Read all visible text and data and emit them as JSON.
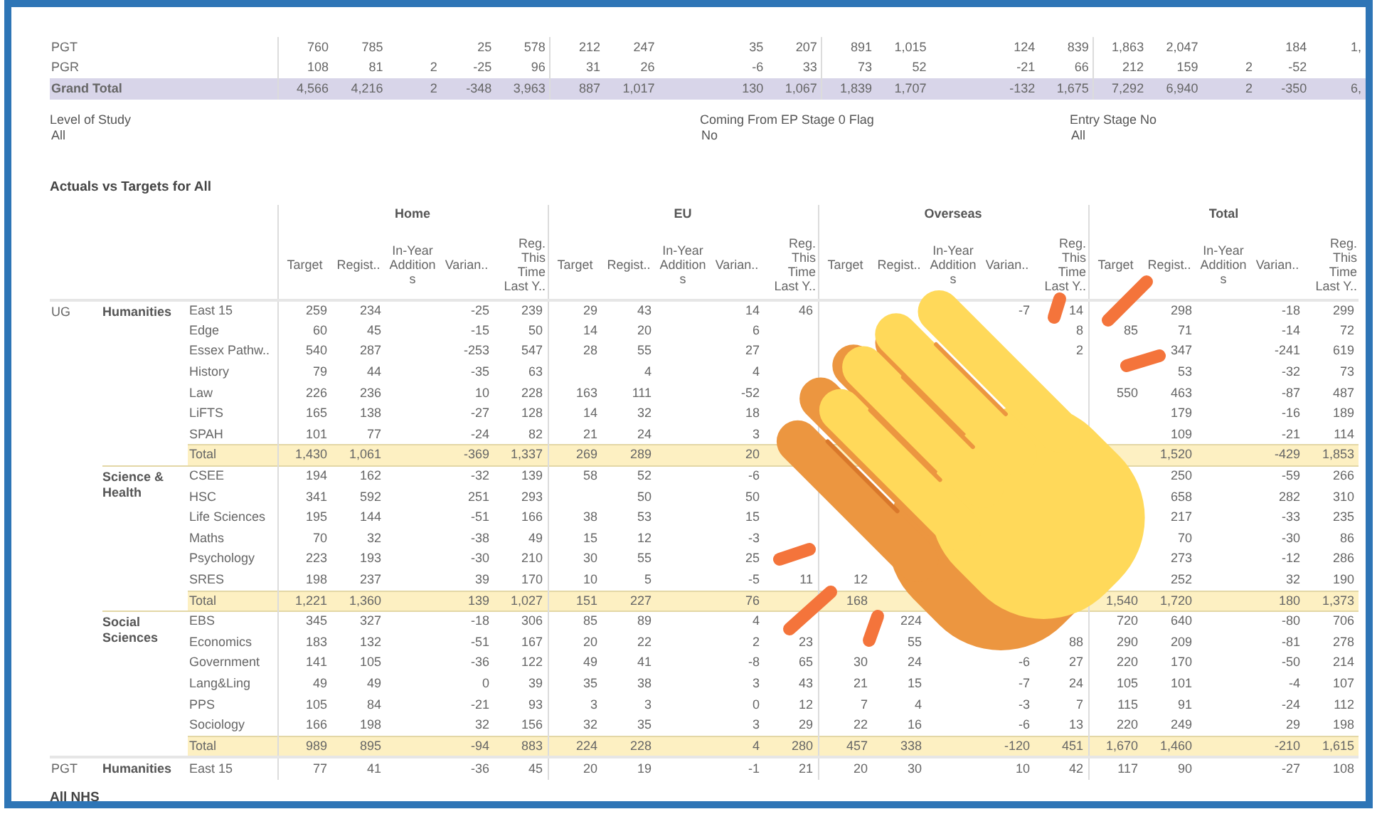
{
  "summary_table": {
    "rows": [
      {
        "label": "PGT",
        "kind": "detail",
        "cells": [
          {
            "target": "760",
            "regist": "785",
            "varian": "25",
            "last_year": "578"
          },
          {
            "target": "212",
            "regist": "247",
            "varian": "35",
            "last_year": "207"
          },
          {
            "target": "891",
            "regist": "1,015",
            "varian": "124",
            "last_year": "839"
          },
          {
            "target": "1,863",
            "regist": "2,047",
            "varian": "184",
            "last_year": "1,"
          }
        ]
      },
      {
        "label": "PGR",
        "kind": "detail",
        "cells": [
          {
            "target": "108",
            "regist": "81",
            "additions": "2",
            "varian": "-25",
            "last_year": "96"
          },
          {
            "target": "31",
            "regist": "26",
            "varian": "-6",
            "last_year": "33"
          },
          {
            "target": "73",
            "regist": "52",
            "varian": "-21",
            "last_year": "66"
          },
          {
            "target": "212",
            "regist": "159",
            "additions": "2",
            "varian": "-52"
          }
        ]
      },
      {
        "label": "Grand Total",
        "kind": "grand_total",
        "cells": [
          {
            "target": "4,566",
            "regist": "4,216",
            "additions": "2",
            "varian": "-348",
            "last_year": "3,963"
          },
          {
            "target": "887",
            "regist": "1,017",
            "varian": "130",
            "last_year": "1,067"
          },
          {
            "target": "1,839",
            "regist": "1,707",
            "varian": "-132",
            "last_year": "1,675"
          },
          {
            "target": "7,292",
            "regist": "6,940",
            "additions": "2",
            "varian": "-350",
            "last_year": "6,"
          }
        ]
      }
    ]
  },
  "filters": [
    {
      "label": "Level of Study",
      "value": "All"
    },
    {
      "label": "Coming From EP Stage 0 Flag",
      "value": "No"
    },
    {
      "label": "Entry Stage No",
      "value": "All"
    }
  ],
  "main_table": {
    "title": "Actuals vs Targets for All",
    "groups": [
      {
        "label": "Home",
        "columns": [
          "Target",
          "Regist..",
          "In-Year Additions",
          "Varian..",
          "Reg. This Time Last Y.."
        ]
      },
      {
        "label": "EU",
        "columns": [
          "Target",
          "Regist..",
          "In-Year Additions",
          "Varian..",
          "Reg. This Time Last Y.."
        ]
      },
      {
        "label": "Overseas",
        "columns": [
          "Target",
          "Regist..",
          "In-Year Additions",
          "Varian..",
          "Reg. This Time Last Y.."
        ]
      },
      {
        "label": "Total",
        "columns": [
          "Target",
          "Regist..",
          "In-Year Additions",
          "Varian..",
          "Reg. This Time Last Y.."
        ]
      }
    ],
    "row_groups": [
      {
        "label": "UG",
        "children": [
          {
            "label": "Humanities",
            "rows": [
              {
                "label": "East 15",
                "kind": "detail",
                "cells": [
                  {
                    "target": "259",
                    "regist": "234",
                    "varian": "-25",
                    "last_year": "239"
                  },
                  {
                    "target": "29",
                    "regist": "43",
                    "varian": "14",
                    "last_year": "46"
                  },
                  {
                    "varian": "-7",
                    "last_year": "14"
                  },
                  {
                    "regist": "298",
                    "varian": "-18",
                    "last_year": "299"
                  }
                ]
              },
              {
                "label": "Edge",
                "kind": "detail",
                "cells": [
                  {
                    "target": "60",
                    "regist": "45",
                    "varian": "-15",
                    "last_year": "50"
                  },
                  {
                    "target": "14",
                    "regist": "20",
                    "varian": "6"
                  },
                  {
                    "last_year": "8"
                  },
                  {
                    "target": "85",
                    "regist": "71",
                    "varian": "-14",
                    "last_year": "72"
                  }
                ]
              },
              {
                "label": "Essex Pathw..",
                "kind": "detail",
                "cells": [
                  {
                    "target": "540",
                    "regist": "287",
                    "varian": "-253",
                    "last_year": "547"
                  },
                  {
                    "target": "28",
                    "regist": "55",
                    "varian": "27"
                  },
                  {
                    "last_year": "2"
                  },
                  {
                    "regist": "347",
                    "varian": "-241",
                    "last_year": "619"
                  }
                ]
              },
              {
                "label": "History",
                "kind": "detail",
                "cells": [
                  {
                    "target": "79",
                    "regist": "44",
                    "varian": "-35",
                    "last_year": "63"
                  },
                  {
                    "regist": "4",
                    "varian": "4"
                  },
                  {},
                  {
                    "regist": "53",
                    "varian": "-32",
                    "last_year": "73"
                  }
                ]
              },
              {
                "label": "Law",
                "kind": "detail",
                "cells": [
                  {
                    "target": "226",
                    "regist": "236",
                    "varian": "10",
                    "last_year": "228"
                  },
                  {
                    "target": "163",
                    "regist": "111",
                    "varian": "-52"
                  },
                  {},
                  {
                    "target": "550",
                    "regist": "463",
                    "varian": "-87",
                    "last_year": "487"
                  }
                ]
              },
              {
                "label": "LiFTS",
                "kind": "detail",
                "cells": [
                  {
                    "target": "165",
                    "regist": "138",
                    "varian": "-27",
                    "last_year": "128"
                  },
                  {
                    "target": "14",
                    "regist": "32",
                    "varian": "18"
                  },
                  {},
                  {
                    "regist": "179",
                    "varian": "-16",
                    "last_year": "189"
                  }
                ]
              },
              {
                "label": "SPAH",
                "kind": "detail",
                "cells": [
                  {
                    "target": "101",
                    "regist": "77",
                    "varian": "-24",
                    "last_year": "82"
                  },
                  {
                    "target": "21",
                    "regist": "24",
                    "varian": "3"
                  },
                  {},
                  {
                    "regist": "109",
                    "varian": "-21",
                    "last_year": "114"
                  }
                ]
              },
              {
                "label": "Total",
                "kind": "total",
                "cells": [
                  {
                    "target": "1,430",
                    "regist": "1,061",
                    "varian": "-369",
                    "last_year": "1,337"
                  },
                  {
                    "target": "269",
                    "regist": "289",
                    "varian": "20"
                  },
                  {},
                  {
                    "regist": "1,520",
                    "varian": "-429",
                    "last_year": "1,853"
                  }
                ]
              }
            ]
          },
          {
            "label": "Science & Health",
            "rows": [
              {
                "label": "CSEE",
                "kind": "detail",
                "cells": [
                  {
                    "target": "194",
                    "regist": "162",
                    "varian": "-32",
                    "last_year": "139"
                  },
                  {
                    "target": "58",
                    "regist": "52",
                    "varian": "-6"
                  },
                  {},
                  {
                    "regist": "250",
                    "varian": "-59",
                    "last_year": "266"
                  }
                ]
              },
              {
                "label": "HSC",
                "kind": "detail",
                "cells": [
                  {
                    "target": "341",
                    "regist": "592",
                    "varian": "251",
                    "last_year": "293"
                  },
                  {
                    "regist": "50",
                    "varian": "50"
                  },
                  {},
                  {
                    "regist": "658",
                    "varian": "282",
                    "last_year": "310"
                  }
                ]
              },
              {
                "label": "Life Sciences",
                "kind": "detail",
                "cells": [
                  {
                    "target": "195",
                    "regist": "144",
                    "varian": "-51",
                    "last_year": "166"
                  },
                  {
                    "target": "38",
                    "regist": "53",
                    "varian": "15"
                  },
                  {},
                  {
                    "regist": "217",
                    "varian": "-33",
                    "last_year": "235"
                  }
                ]
              },
              {
                "label": "Maths",
                "kind": "detail",
                "cells": [
                  {
                    "target": "70",
                    "regist": "32",
                    "varian": "-38",
                    "last_year": "49"
                  },
                  {
                    "target": "15",
                    "regist": "12",
                    "varian": "-3"
                  },
                  {},
                  {
                    "regist": "70",
                    "varian": "-30",
                    "last_year": "86"
                  }
                ]
              },
              {
                "label": "Psychology",
                "kind": "detail",
                "cells": [
                  {
                    "target": "223",
                    "regist": "193",
                    "varian": "-30",
                    "last_year": "210"
                  },
                  {
                    "target": "30",
                    "regist": "55",
                    "varian": "25"
                  },
                  {},
                  {
                    "regist": "273",
                    "varian": "-12",
                    "last_year": "286"
                  }
                ]
              },
              {
                "label": "SRES",
                "kind": "detail",
                "cells": [
                  {
                    "target": "198",
                    "regist": "237",
                    "varian": "39",
                    "last_year": "170"
                  },
                  {
                    "target": "10",
                    "regist": "5",
                    "varian": "-5",
                    "last_year": "11"
                  },
                  {
                    "target": "12"
                  },
                  {
                    "regist": "252",
                    "varian": "32",
                    "last_year": "190"
                  }
                ]
              },
              {
                "label": "Total",
                "kind": "total",
                "cells": [
                  {
                    "target": "1,221",
                    "regist": "1,360",
                    "varian": "139",
                    "last_year": "1,027"
                  },
                  {
                    "target": "151",
                    "regist": "227",
                    "varian": "76"
                  },
                  {
                    "target": "168"
                  },
                  {
                    "target": "1,540",
                    "regist": "1,720",
                    "varian": "180",
                    "last_year": "1,373"
                  }
                ]
              }
            ]
          },
          {
            "label": "Social Sciences",
            "rows": [
              {
                "label": "EBS",
                "kind": "detail",
                "cells": [
                  {
                    "target": "345",
                    "regist": "327",
                    "varian": "-18",
                    "last_year": "306"
                  },
                  {
                    "target": "85",
                    "regist": "89",
                    "varian": "4"
                  },
                  {
                    "regist": "224"
                  },
                  {
                    "target": "720",
                    "regist": "640",
                    "varian": "-80",
                    "last_year": "706"
                  }
                ]
              },
              {
                "label": "Economics",
                "kind": "detail",
                "cells": [
                  {
                    "target": "183",
                    "regist": "132",
                    "varian": "-51",
                    "last_year": "167"
                  },
                  {
                    "target": "20",
                    "regist": "22",
                    "varian": "2",
                    "last_year": "23"
                  },
                  {
                    "regist": "55",
                    "last_year": "88"
                  },
                  {
                    "target": "290",
                    "regist": "209",
                    "varian": "-81",
                    "last_year": "278"
                  }
                ]
              },
              {
                "label": "Government",
                "kind": "detail",
                "cells": [
                  {
                    "target": "141",
                    "regist": "105",
                    "varian": "-36",
                    "last_year": "122"
                  },
                  {
                    "target": "49",
                    "regist": "41",
                    "varian": "-8",
                    "last_year": "65"
                  },
                  {
                    "target": "30",
                    "regist": "24",
                    "varian": "-6",
                    "last_year": "27"
                  },
                  {
                    "target": "220",
                    "regist": "170",
                    "varian": "-50",
                    "last_year": "214"
                  }
                ]
              },
              {
                "label": "Lang&Ling",
                "kind": "detail",
                "cells": [
                  {
                    "target": "49",
                    "regist": "49",
                    "varian": "0",
                    "last_year": "39"
                  },
                  {
                    "target": "35",
                    "regist": "38",
                    "varian": "3",
                    "last_year": "43"
                  },
                  {
                    "target": "21",
                    "regist": "15",
                    "varian": "-7",
                    "last_year": "24"
                  },
                  {
                    "target": "105",
                    "regist": "101",
                    "varian": "-4",
                    "last_year": "107"
                  }
                ]
              },
              {
                "label": "PPS",
                "kind": "detail",
                "cells": [
                  {
                    "target": "105",
                    "regist": "84",
                    "varian": "-21",
                    "last_year": "93"
                  },
                  {
                    "target": "3",
                    "regist": "3",
                    "varian": "0",
                    "last_year": "12"
                  },
                  {
                    "target": "7",
                    "regist": "4",
                    "varian": "-3",
                    "last_year": "7"
                  },
                  {
                    "target": "115",
                    "regist": "91",
                    "varian": "-24",
                    "last_year": "112"
                  }
                ]
              },
              {
                "label": "Sociology",
                "kind": "detail",
                "cells": [
                  {
                    "target": "166",
                    "regist": "198",
                    "varian": "32",
                    "last_year": "156"
                  },
                  {
                    "target": "32",
                    "regist": "35",
                    "varian": "3",
                    "last_year": "29"
                  },
                  {
                    "target": "22",
                    "regist": "16",
                    "varian": "-6",
                    "last_year": "13"
                  },
                  {
                    "target": "220",
                    "regist": "249",
                    "varian": "29",
                    "last_year": "198"
                  }
                ]
              },
              {
                "label": "Total",
                "kind": "total",
                "cells": [
                  {
                    "target": "989",
                    "regist": "895",
                    "varian": "-94",
                    "last_year": "883"
                  },
                  {
                    "target": "224",
                    "regist": "228",
                    "varian": "4",
                    "last_year": "280"
                  },
                  {
                    "target": "457",
                    "regist": "338",
                    "varian": "-120",
                    "last_year": "451"
                  },
                  {
                    "target": "1,670",
                    "regist": "1,460",
                    "varian": "-210",
                    "last_year": "1,615"
                  }
                ]
              }
            ]
          }
        ]
      },
      {
        "label": "PGT",
        "children": [
          {
            "label": "Humanities",
            "rows": [
              {
                "label": "East 15",
                "kind": "detail",
                "cells": [
                  {
                    "target": "77",
                    "regist": "41",
                    "varian": "-36",
                    "last_year": "45"
                  },
                  {
                    "target": "20",
                    "regist": "19",
                    "varian": "-1",
                    "last_year": "21"
                  },
                  {
                    "target": "20",
                    "regist": "30",
                    "varian": "10",
                    "last_year": "42"
                  },
                  {
                    "target": "117",
                    "regist": "90",
                    "varian": "-27",
                    "last_year": "108"
                  }
                ]
              }
            ]
          }
        ]
      }
    ]
  },
  "next_section": {
    "title": "All NHS"
  }
}
